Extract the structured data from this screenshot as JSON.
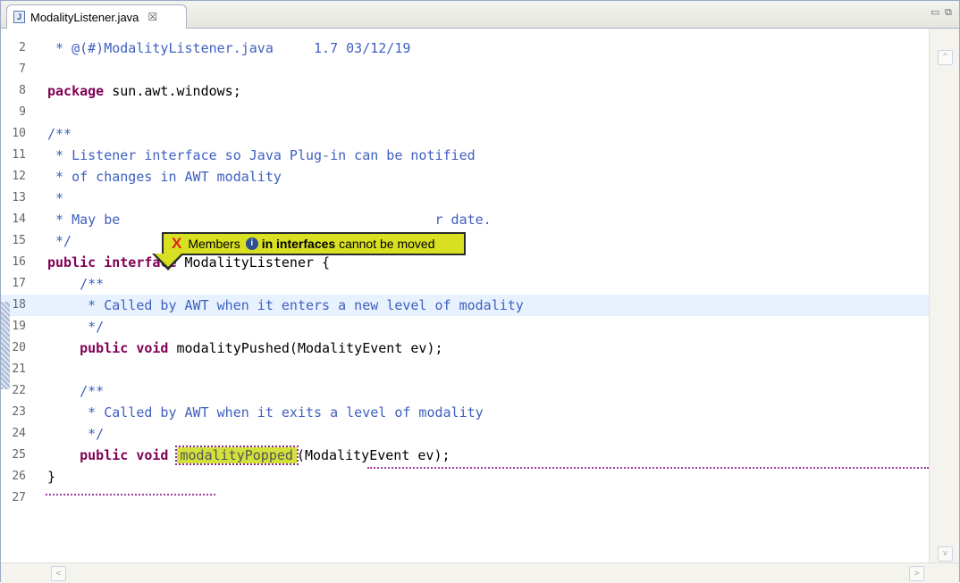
{
  "tab": {
    "title": "ModalityListener.java",
    "close_glyph": "☒"
  },
  "window_controls": {
    "minimize": "▭",
    "maximize": "⧉"
  },
  "lines": [
    {
      "n": "2",
      "text": " * @(#)ModalityListener.java     1.7 03/12/19",
      "type": "comment"
    },
    {
      "n": "7",
      "text": "",
      "type": "plain"
    },
    {
      "n": "8",
      "kw": "package",
      "rest": " sun.awt.windows;",
      "type": "kwline"
    },
    {
      "n": "9",
      "text": "",
      "type": "plain"
    },
    {
      "n": "10",
      "text": "/**",
      "type": "comment"
    },
    {
      "n": "11",
      "text": " * Listener interface so Java Plug-in can be notified",
      "type": "comment"
    },
    {
      "n": "12",
      "text": " * of changes in AWT modality",
      "type": "comment"
    },
    {
      "n": "13",
      "text": " *",
      "type": "comment"
    },
    {
      "n": "14",
      "text": " * May be                                       r date.",
      "type": "comment"
    },
    {
      "n": "15",
      "text": " */",
      "type": "comment"
    },
    {
      "n": "16",
      "kw": "public interface",
      "rest": " ModalityListener {",
      "type": "kwline"
    },
    {
      "n": "17",
      "text": "    /**",
      "type": "comment"
    },
    {
      "n": "18",
      "text": "     * Called by AWT when it enters a new level of modality",
      "type": "comment"
    },
    {
      "n": "19",
      "text": "     */",
      "type": "comment"
    },
    {
      "n": "20",
      "kw": "    public void",
      "rest": " modalityPushed(ModalityEvent ev);",
      "type": "kwline"
    },
    {
      "n": "21",
      "text": "",
      "type": "plain"
    },
    {
      "n": "22",
      "text": "    /**",
      "type": "comment"
    },
    {
      "n": "23",
      "text": "     * Called by AWT when it exits a level of modality",
      "type": "comment"
    },
    {
      "n": "24",
      "text": "     */",
      "type": "comment"
    },
    {
      "n": "25",
      "kw": "    public void",
      "highlight": "modalityPopped",
      "rest": "(ModalityEvent ev);",
      "type": "kwhl"
    },
    {
      "n": "26",
      "text": "}",
      "type": "plain"
    },
    {
      "n": "27",
      "text": "",
      "type": "plain"
    }
  ],
  "tooltip": {
    "error_glyph": "X",
    "part1": "Members",
    "info_glyph": "i",
    "part2": "in interfaces",
    "part3": "cannot be moved"
  },
  "scroll": {
    "up": "^",
    "down": "v",
    "left": "<",
    "right": ">"
  },
  "colors": {
    "keyword": "#7f0055",
    "comment": "#3f5fbf",
    "tooltip_bg": "#d8e021",
    "current_line": "#e8f2fe"
  }
}
